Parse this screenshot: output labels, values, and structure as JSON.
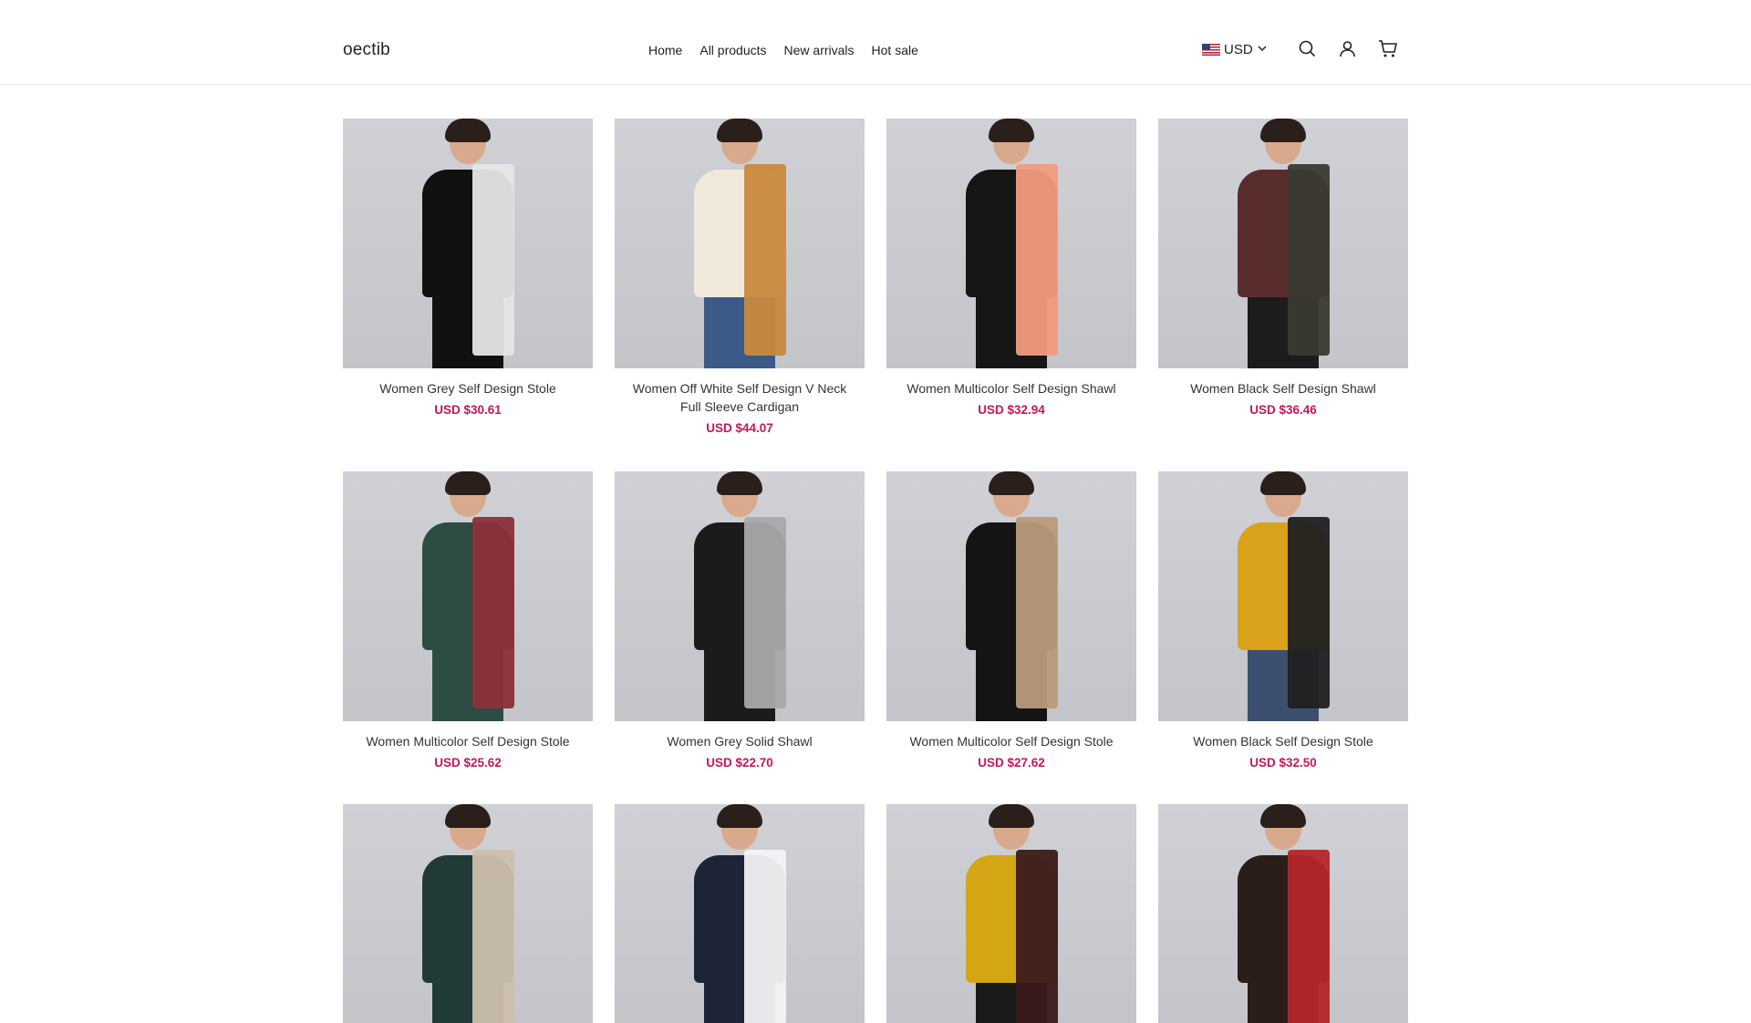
{
  "header": {
    "logo": "oectib",
    "nav": [
      "Home",
      "All products",
      "New arrivals",
      "Hot sale"
    ],
    "currency": "USD",
    "icons": [
      "search-icon",
      "account-icon",
      "cart-icon"
    ]
  },
  "products": [
    {
      "title": "Women Grey Self Design Stole",
      "price": "USD $30.61",
      "top": "#111111",
      "scarf": "#e6e6e6",
      "bottom": "#111111"
    },
    {
      "title": "Women Off White Self Design V Neck Full Sleeve Cardigan",
      "price": "USD $44.07",
      "top": "#f1e9da",
      "scarf": "#c9893f",
      "bottom": "#3b5a88"
    },
    {
      "title": "Women Multicolor Self Design Shawl",
      "price": "USD $32.94",
      "top": "#161616",
      "scarf": "#f29a7f",
      "bottom": "#161616"
    },
    {
      "title": "Women Black Self Design Shawl",
      "price": "USD $36.46",
      "top": "#5a2d2d",
      "scarf": "#3a3a32",
      "bottom": "#1c1c1c"
    },
    {
      "title": "Women Multicolor Self Design Stole",
      "price": "USD $25.62",
      "top": "#2d4c42",
      "scarf": "#8c2f3a",
      "bottom": "#2d4c42"
    },
    {
      "title": "Women Grey Solid Shawl",
      "price": "USD $22.70",
      "top": "#1b1b1b",
      "scarf": "#a9a9ab",
      "bottom": "#1b1b1b"
    },
    {
      "title": "Women Multicolor Self Design Stole",
      "price": "USD $27.62",
      "top": "#141414",
      "scarf": "#b99a7b",
      "bottom": "#141414"
    },
    {
      "title": "Women Black Self Design Stole",
      "price": "USD $32.50",
      "top": "#d9a21b",
      "scarf": "#202020",
      "bottom": "#3d4f6e"
    },
    {
      "title": "",
      "price": "",
      "top": "#213a36",
      "scarf": "#cdbfae",
      "bottom": "#213a36"
    },
    {
      "title": "",
      "price": "",
      "top": "#1d2438",
      "scarf": "#f3f3f3",
      "bottom": "#1d2438"
    },
    {
      "title": "",
      "price": "",
      "top": "#d4a514",
      "scarf": "#3a1a1a",
      "bottom": "#1a1a1a"
    },
    {
      "title": "",
      "price": "",
      "top": "#2a1d1a",
      "scarf": "#b3262a",
      "bottom": "#2a1d1a"
    }
  ]
}
